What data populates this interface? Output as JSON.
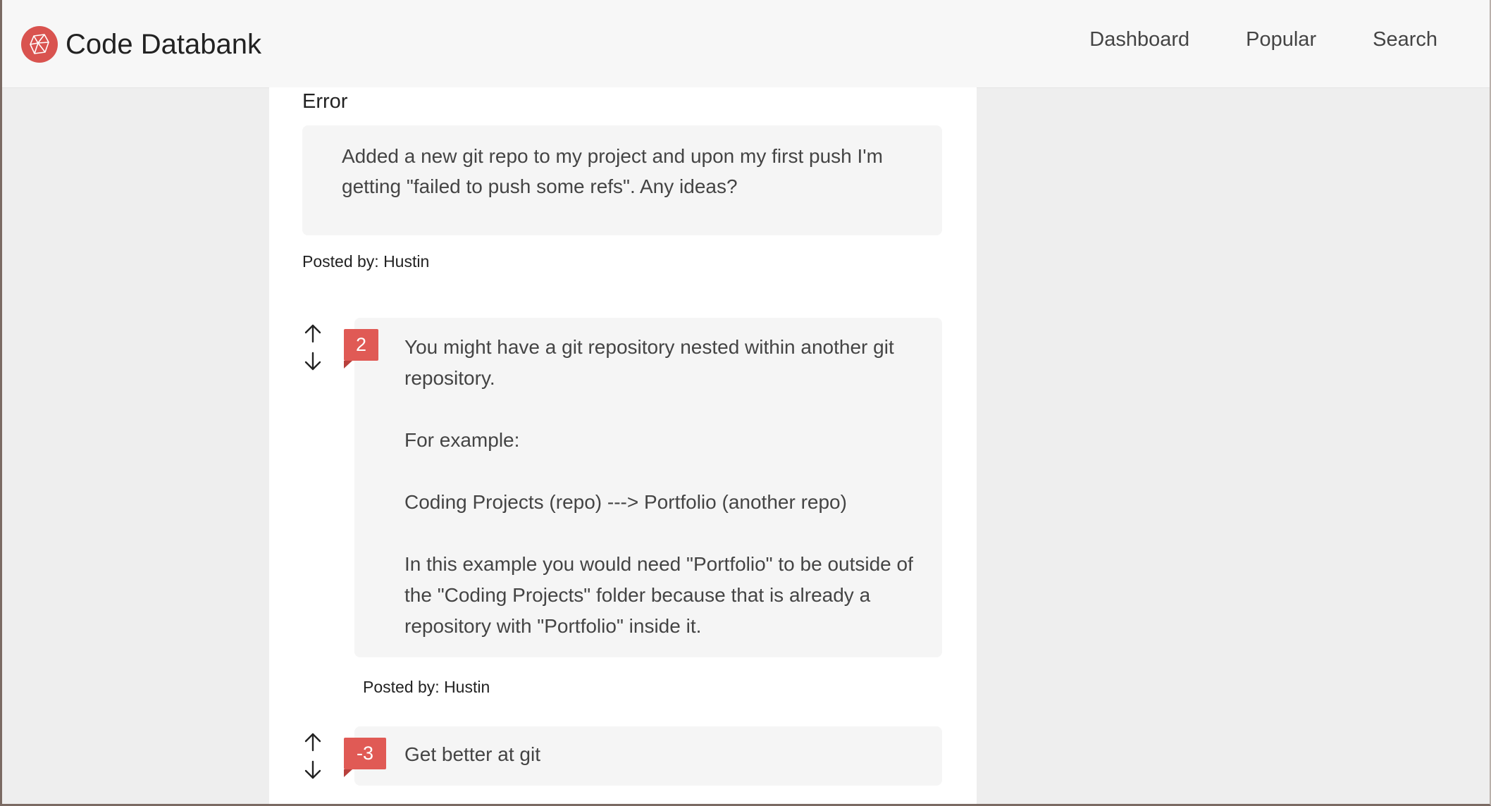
{
  "header": {
    "brand": "Code Databank",
    "nav": [
      "Dashboard",
      "Popular",
      "Search"
    ]
  },
  "question": {
    "title": "Error",
    "body": "Added a new git repo to my project and upon my first push I'm getting \"failed to push some refs\". Any ideas?",
    "posted_by": "Posted by: Hustin"
  },
  "answers": [
    {
      "score": "2",
      "paragraphs": [
        "You might have a git repository nested within another git repository.",
        "For example:",
        "Coding Projects (repo) ---> Portfolio (another repo)",
        "In this example you would need \"Portfolio\" to be outside of the \"Coding Projects\" folder because that is already a repository with \"Portfolio\" inside it."
      ],
      "posted_by": "Posted by: Hustin"
    },
    {
      "score": "-3",
      "paragraphs": [
        "Get better at git"
      ]
    }
  ],
  "icons": {
    "logo": "polyhedron-logo-icon",
    "upvote": "arrow-up-icon",
    "downvote": "arrow-down-icon"
  },
  "colors": {
    "accent": "#e05a55",
    "navbar_bg": "#f7f7f7",
    "card_bg": "#ffffff",
    "box_bg": "#f5f5f5",
    "page_bg": "#eeeeee"
  }
}
